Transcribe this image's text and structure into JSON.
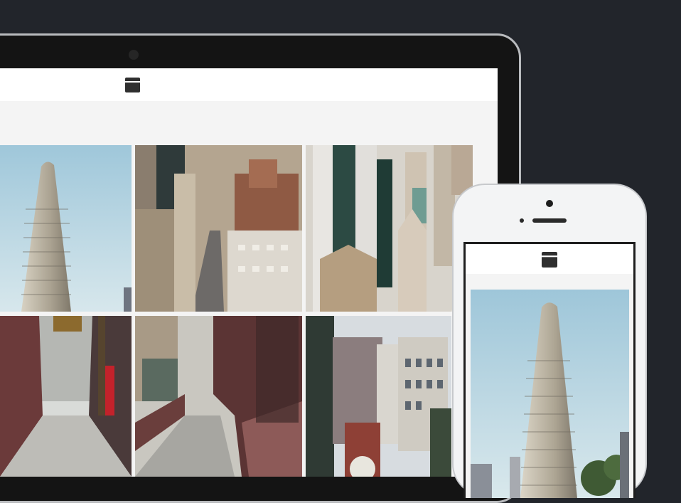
{
  "theme": {
    "background": "#22252b",
    "device_frame": "#141414",
    "screen_background": "#f4f4f4",
    "header_background": "#ffffff",
    "icon_color": "#2f2f2f"
  },
  "laptop": {
    "header": {
      "icon": "gallery-app-icon"
    },
    "gallery": {
      "photos": [
        {
          "subject": "flatiron-building",
          "icon": "photo-icon"
        },
        {
          "subject": "city-street-aerial",
          "icon": "photo-icon"
        },
        {
          "subject": "skyscrapers-aerial",
          "icon": "photo-icon"
        },
        {
          "subject": "bridge-walkway",
          "icon": "photo-icon"
        },
        {
          "subject": "bridge-railing",
          "icon": "photo-icon"
        },
        {
          "subject": "old-buildings",
          "icon": "photo-icon"
        }
      ]
    }
  },
  "phone": {
    "header": {
      "icon": "gallery-app-icon"
    },
    "photo": {
      "subject": "flatiron-building",
      "icon": "photo-icon"
    }
  }
}
